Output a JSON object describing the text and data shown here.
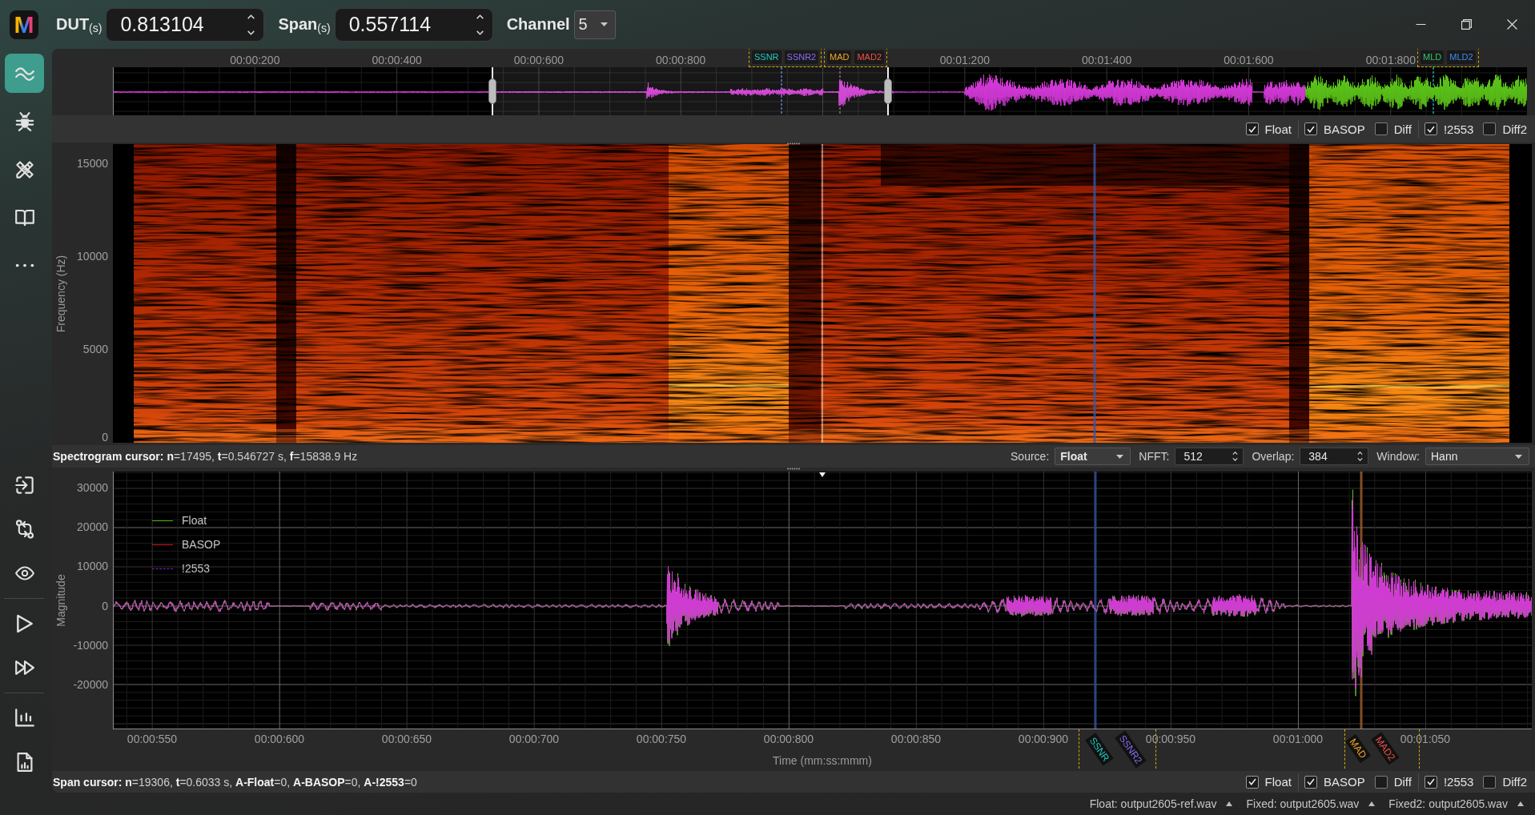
{
  "title_bar": {
    "logo": "M",
    "fields": [
      {
        "label": "DUT$_{(s)}$",
        "value": "0.813104"
      },
      {
        "label": "Span$_{(s)}$",
        "value": "0.557114"
      }
    ],
    "channel": {
      "label": "Channel",
      "value": "5"
    }
  },
  "sidebar": {
    "items": [
      {
        "selected": true
      },
      {
        "selected": false
      },
      {
        "selected": false
      },
      {
        "selected": false
      },
      {
        "selected": false
      }
    ]
  },
  "overview": {
    "ticks": [
      "00:00:200",
      "00:00:400",
      "00:00:600",
      "00:00:800",
      "00:01:200",
      "00:01:400",
      "00:01:600",
      "00:01:800"
    ],
    "markers": [
      {
        "labels": [
          {
            "text": "SSNR",
            "color": "#1ec8c0"
          },
          {
            "text": "SSNR2",
            "color": "#8a6cf5"
          }
        ]
      },
      {
        "labels": [
          {
            "text": "MAD",
            "color": "#f5a623"
          },
          {
            "text": "MAD2",
            "color": "#f0504a"
          }
        ]
      },
      {
        "labels": [
          {
            "text": "MLD",
            "color": "#2ec86a"
          },
          {
            "text": "MLD2",
            "color": "#3d8ef0"
          }
        ]
      }
    ],
    "series_toggles": [
      {
        "items": [
          {
            "label": "Float",
            "checked": true
          }
        ]
      },
      {
        "items": [
          {
            "label": "BASOP",
            "checked": true
          },
          {
            "label": "Diff",
            "checked": false
          }
        ]
      },
      {
        "items": [
          {
            "label": "!2553",
            "checked": true
          },
          {
            "label": "Diff2",
            "checked": false
          }
        ]
      }
    ]
  },
  "spectrogram": {
    "y_label": "Frequency (Hz)",
    "y_ticks": [
      "15000",
      "10000",
      "5000",
      "0"
    ],
    "cursor_readout": "**Spectrogram cursor:** **n**=17495, **t**=0.546727 s, **f**=15838.9 Hz",
    "controls": [
      {
        "kind": "dropdown",
        "label": "Source:",
        "value": "Float"
      },
      {
        "kind": "spinbox",
        "label": "NFFT:",
        "value": "512"
      },
      {
        "kind": "spinbox",
        "label": "Overlap:",
        "value": "384"
      },
      {
        "kind": "dropdown",
        "label": "Window:",
        "value": "Hann"
      }
    ]
  },
  "waveform": {
    "y_label": "Magnitude",
    "y_ticks": [
      "30000",
      "20000",
      "10000",
      "0",
      "-10000",
      "-20000"
    ],
    "x_ticks": [
      "00:00:550",
      "00:00:600",
      "00:00:650",
      "00:00:700",
      "00:00:750",
      "00:00:800",
      "00:00:850",
      "00:00:900",
      "00:00:950",
      "00:01:000",
      "00:01:050"
    ],
    "x_label": "Time (mm:ss:mmm)",
    "legend": [
      {
        "label": "Float",
        "color": "#46b400",
        "dashed": false
      },
      {
        "label": "BASOP",
        "color": "#d01818",
        "dashed": false
      },
      {
        "label": "!2553",
        "color": "#7a1fc8",
        "dashed": true
      }
    ],
    "markers": [
      {
        "labels": [
          {
            "text": "SSNR",
            "color": "#1ec8c0"
          },
          {
            "text": "SSNR2",
            "color": "#8a6cf5"
          }
        ]
      },
      {
        "labels": [
          {
            "text": "MAD",
            "color": "#f5a623"
          },
          {
            "text": "MAD2",
            "color": "#f0504a"
          }
        ]
      }
    ],
    "cursor_readout": "**Span cursor:** **n**=19306, **t**=0.6033 s, **A-Float**=0, **A-BASOP**=0, **A-!2553**=0",
    "series_toggles": [
      {
        "items": [
          {
            "label": "Float",
            "checked": true
          }
        ]
      },
      {
        "items": [
          {
            "label": "BASOP",
            "checked": true
          },
          {
            "label": "Diff",
            "checked": false
          }
        ]
      },
      {
        "items": [
          {
            "label": "!2553",
            "checked": true
          },
          {
            "label": "Diff2",
            "checked": false
          }
        ]
      }
    ]
  },
  "status_bar": {
    "files": [
      "Float: output2605-ref.wav",
      "Fixed: output2605.wav",
      "Fixed2: output2605.wav"
    ]
  }
}
